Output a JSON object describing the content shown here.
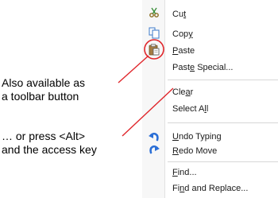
{
  "menu": {
    "cut": [
      "Cu",
      "t",
      ""
    ],
    "copy": [
      "Cop",
      "y",
      ""
    ],
    "paste": [
      "",
      "P",
      "aste"
    ],
    "paste_special": [
      "Past",
      "e",
      " Special..."
    ],
    "clear": [
      "Cle",
      "a",
      "r"
    ],
    "select_all": [
      "Select A",
      "l",
      "l"
    ],
    "undo": [
      "",
      "U",
      "ndo Typing"
    ],
    "redo": [
      "",
      "R",
      "edo Move"
    ],
    "find": [
      "",
      "F",
      "ind..."
    ],
    "find_replace": [
      "Fi",
      "n",
      "d and Replace..."
    ]
  },
  "callouts": {
    "toolbar_line1": "Also available as",
    "toolbar_line2": "a toolbar button",
    "alt_line1": "… or press <Alt>",
    "alt_line2": "and the access key"
  },
  "icons": {
    "cut": "scissors-icon",
    "copy": "copy-icon",
    "paste": "paste-icon",
    "undo": "undo-icon",
    "redo": "redo-icon"
  },
  "colors": {
    "annotation_red": "#e0262b",
    "icon_blue": "#2b6fd6"
  }
}
